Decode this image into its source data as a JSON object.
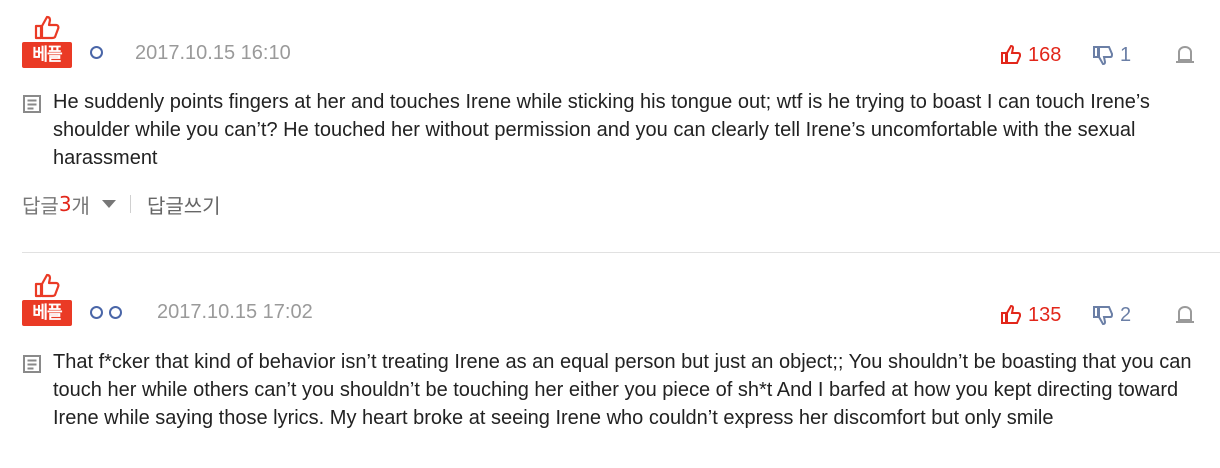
{
  "comments": [
    {
      "badge": "베플",
      "date": "2017.10.15 16:10",
      "likes": "168",
      "dislikes": "1",
      "text": "He suddenly points fingers at her and touches Irene while sticking his tongue out; wtf is he trying to boast I can touch Irene’s shoulder while you can’t? He touched her without permission and you can clearly tell Irene’s uncomfortable with the sexual harassment",
      "reply_label": "답글 ",
      "reply_count": "3",
      "reply_unit": "개",
      "write_reply": "답글쓰기"
    },
    {
      "badge": "베플",
      "date": "2017.10.15 17:02",
      "likes": "135",
      "dislikes": "2",
      "text": "That f*cker that kind of behavior isn’t treating Irene as an equal person but just an object;; You shouldn’t be boasting that you can touch her while others can’t you shouldn’t be touching her either you piece of sh*t And I barfed at how you kept directing toward Irene while saying those lyrics. My heart broke at seeing Irene who couldn’t express her discomfort but only smile"
    }
  ],
  "colors": {
    "accent_red": "#ea3a25",
    "dislike_blue": "#6b7fa6",
    "date_gray": "#9a9a9a"
  },
  "icons": [
    "thumbs-up-icon",
    "user-level-dot-icon",
    "dislike-icon",
    "report-icon",
    "memo-icon",
    "caret-down-icon"
  ]
}
